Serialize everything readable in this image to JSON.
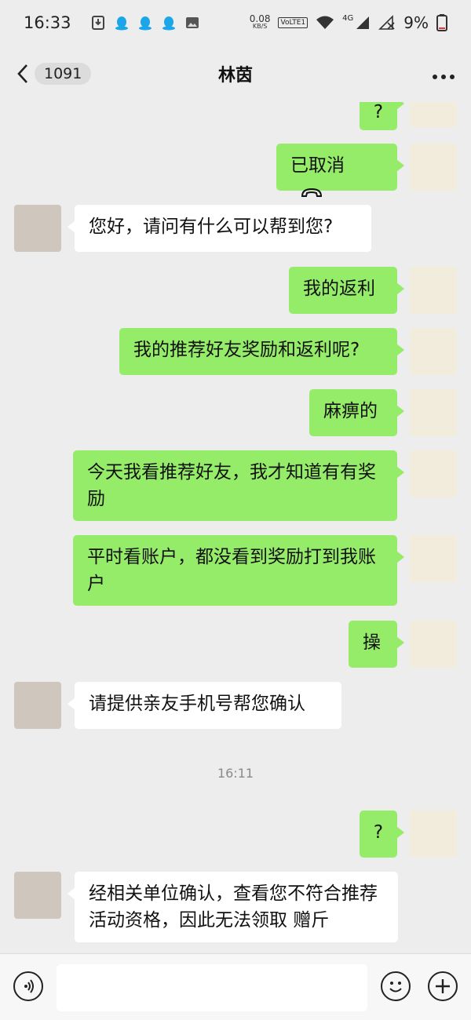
{
  "status_bar": {
    "time": "16:33",
    "net_speed_value": "0.08",
    "net_speed_unit": "KB/S",
    "volte": "VoLTE1",
    "network": "4G",
    "battery": "9%"
  },
  "header": {
    "unread_count": "1091",
    "title": "林茵"
  },
  "messages": [
    {
      "side": "out",
      "text": "?"
    },
    {
      "side": "out",
      "text": "已取消",
      "icon": "hangup-icon"
    },
    {
      "side": "in",
      "text": "您好，请问有什么可以帮到您?"
    },
    {
      "side": "out",
      "text": "我的返利"
    },
    {
      "side": "out",
      "text": "我的推荐好友奖励和返利呢?"
    },
    {
      "side": "out",
      "text": "麻痹的"
    },
    {
      "side": "out",
      "text": "今天我看推荐好友，我才知道有有奖励"
    },
    {
      "side": "out",
      "text": "平时看账户，都没看到奖励打到我账户"
    },
    {
      "side": "out",
      "text": "操"
    },
    {
      "side": "in",
      "text": "请提供亲友手机号帮您确认"
    },
    {
      "side": "time",
      "text": "16:11"
    },
    {
      "side": "out",
      "text": "?"
    },
    {
      "side": "in",
      "text": "经相关单位确认，查看您不符合推荐活动资格，因此无法领取 赠斤"
    }
  ],
  "input_bar": {
    "value": "",
    "left_icon": "voice-icon",
    "emoji_icon": "emoji-icon",
    "plus_icon": "plus-icon"
  },
  "colors": {
    "background": "#ededed",
    "outgoing_bubble": "#95ec69",
    "incoming_bubble": "#ffffff"
  }
}
